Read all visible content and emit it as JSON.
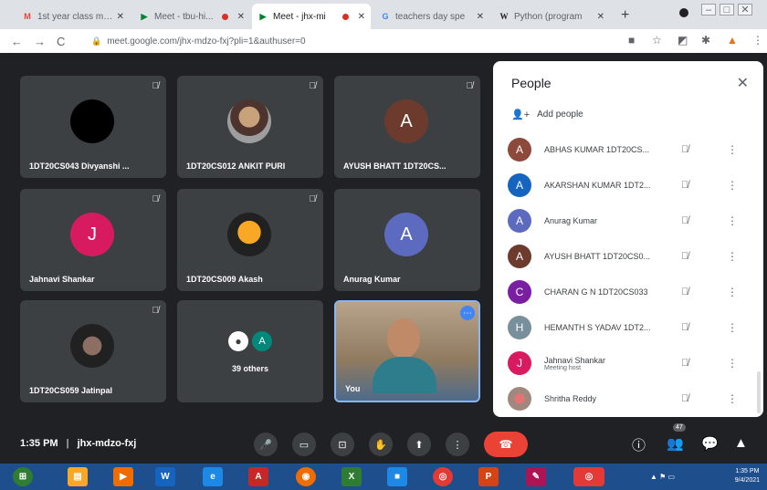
{
  "browser": {
    "tabs": [
      {
        "title": "1st year class mee",
        "favicon": "M",
        "color": "#ea4335",
        "recording": false
      },
      {
        "title": "Meet - tbu-hi...",
        "favicon": "▶",
        "color": "#00832d",
        "recording": true
      },
      {
        "title": "Meet - jhx-mi",
        "favicon": "▶",
        "color": "#00832d",
        "recording": true,
        "active": true
      },
      {
        "title": "teachers day spe",
        "favicon": "G",
        "color": "#4285f4",
        "recording": false
      },
      {
        "title": "Python (program",
        "favicon": "W",
        "color": "#202124",
        "recording": false
      }
    ],
    "new_tab": "+",
    "url": "meet.google.com/jhx-mdzo-fxj?pli=1&authuser=0"
  },
  "participants": {
    "tiles": [
      {
        "name": "1DT20CS043 Divyanshi ...",
        "initial": "",
        "color": "#000000"
      },
      {
        "name": "1DT20CS012 ANKIT PURI",
        "initial": "",
        "color": "#6d4c41"
      },
      {
        "name": "AYUSH BHATT 1DT20CS...",
        "initial": "A",
        "color": "#6d3b2e"
      },
      {
        "name": "Jahnavi Shankar",
        "initial": "J",
        "color": "#d81b60"
      },
      {
        "name": "1DT20CS009 Akash",
        "initial": "",
        "color": "#2b2b2b"
      },
      {
        "name": "Anurag Kumar",
        "initial": "A",
        "color": "#5c6bc0"
      },
      {
        "name": "1DT20CS059 Jatinpal",
        "initial": "",
        "color": "#3e2723"
      },
      {
        "name": "39 others",
        "initial": "A",
        "color": "#00897b"
      },
      {
        "name": "You",
        "initial": "",
        "color": "#795548"
      }
    ]
  },
  "people_panel": {
    "title": "People",
    "add_label": "Add people",
    "list": [
      {
        "name": "ABHAS KUMAR 1DT20CS...",
        "initial": "A",
        "color": "#8d4a3a"
      },
      {
        "name": "AKARSHAN KUMAR 1DT2...",
        "initial": "A",
        "color": "#1565c0"
      },
      {
        "name": "Anurag Kumar",
        "initial": "A",
        "color": "#5c6bc0"
      },
      {
        "name": "AYUSH BHATT 1DT20CS0...",
        "initial": "A",
        "color": "#6d3b2e"
      },
      {
        "name": "CHARAN G N 1DT20CS033",
        "initial": "C",
        "color": "#7b1fa2"
      },
      {
        "name": "HEMANTH S YADAV 1DT2...",
        "initial": "H",
        "color": "#78909c"
      },
      {
        "name": "Jahnavi Shankar",
        "sub": "Meeting host",
        "initial": "J",
        "color": "#d81b60"
      },
      {
        "name": "Shritha Reddy",
        "initial": "",
        "color": "#a1887f"
      }
    ]
  },
  "bottom_bar": {
    "time": "1:35 PM",
    "separator": "|",
    "meeting_code": "jhx-mdzo-fxj",
    "participant_count": "47"
  },
  "taskbar": {
    "clock_time": "1:35 PM",
    "clock_date": "9/4/2021"
  }
}
